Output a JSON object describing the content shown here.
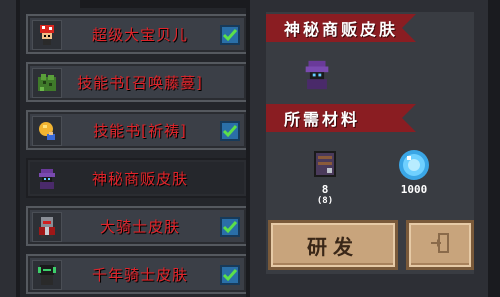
{
  "list": {
    "items": [
      {
        "label": "超级大宝贝儿",
        "icon": "red-mushroom-character-icon",
        "checked": true,
        "selected": false
      },
      {
        "label": "技能书[召唤藤蔓]",
        "icon": "vine-plant-icon",
        "checked": false,
        "selected": false
      },
      {
        "label": "技能书[祈祷]",
        "icon": "praying-hand-icon",
        "checked": true,
        "selected": false
      },
      {
        "label": "神秘商贩皮肤",
        "icon": "hooded-merchant-icon",
        "checked": false,
        "selected": true
      },
      {
        "label": "大骑士皮肤",
        "icon": "knight-helmet-icon",
        "checked": true,
        "selected": false
      },
      {
        "label": "千年骑士皮肤",
        "icon": "dark-knight-icon",
        "checked": true,
        "selected": false
      }
    ]
  },
  "detail": {
    "title": "神秘商贩皮肤",
    "materials_header": "所需材料",
    "materials": [
      {
        "icon": "material-crate-icon",
        "amount": "8",
        "owned": "(8)"
      },
      {
        "icon": "blue-gem-icon",
        "amount": "1000"
      }
    ]
  },
  "buttons": {
    "research_label": "研发",
    "exit_icon": "exit-door-icon"
  },
  "colors": {
    "label_red": "#e0242a",
    "banner_red": "#8a1d22",
    "button_tan": "#c8a47c",
    "check_blue": "#2a6fa8",
    "check_green": "#5ce04a"
  }
}
